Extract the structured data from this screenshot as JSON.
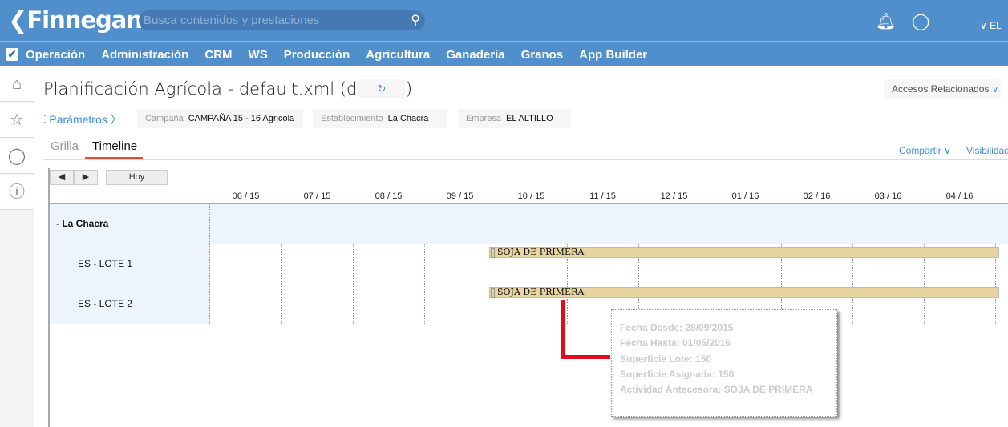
{
  "header": {
    "brand": "Finnegans",
    "search_placeholder": "Busca contenidos y prestaciones",
    "user": "EL"
  },
  "nav": [
    "Operación",
    "Administración",
    "CRM",
    "WS",
    "Producción",
    "Agricultura",
    "Ganadería",
    "Granos",
    "App Builder"
  ],
  "page": {
    "title": "Planificación Agrícola - default.xml (default)",
    "accesos": "Accesos Relacionados",
    "params": "Parámetros",
    "filters": [
      {
        "label": "Campaña",
        "value": "CAMPAÑA 15 - 16 Agricola"
      },
      {
        "label": "Establecimiento",
        "value": "La Chacra"
      },
      {
        "label": "Empresa",
        "value": "EL ALTILLO"
      }
    ],
    "tabs": [
      "Grilla",
      "Timeline"
    ],
    "active_tab": "Timeline",
    "compartir": "Compartir",
    "visibilidad": "Visibilidad"
  },
  "timeline": {
    "prev": "◀",
    "next": "▶",
    "today": "Hoy",
    "months": [
      "06 / 15",
      "07 / 15",
      "08 / 15",
      "09 / 15",
      "10 / 15",
      "11 / 15",
      "12 / 15",
      "01 / 16",
      "02 / 16",
      "03 / 16",
      "04 / 16"
    ],
    "group": "-  La Chacra",
    "rows": [
      {
        "label": "ES - LOTE 1",
        "task": "SOJA DE PRIMERA"
      },
      {
        "label": "ES - LOTE 2",
        "task": "SOJA DE PRIMERA"
      }
    ],
    "task_color": "#e8d49f"
  },
  "tooltip": [
    "Fecha Desde: 28/09/2015",
    "Fecha Hasta: 01/05/2016",
    "Superficie Lote: 150",
    "Superficie Asignada: 150",
    "Actividad Antecesora: SOJA DE PRIMERA"
  ]
}
